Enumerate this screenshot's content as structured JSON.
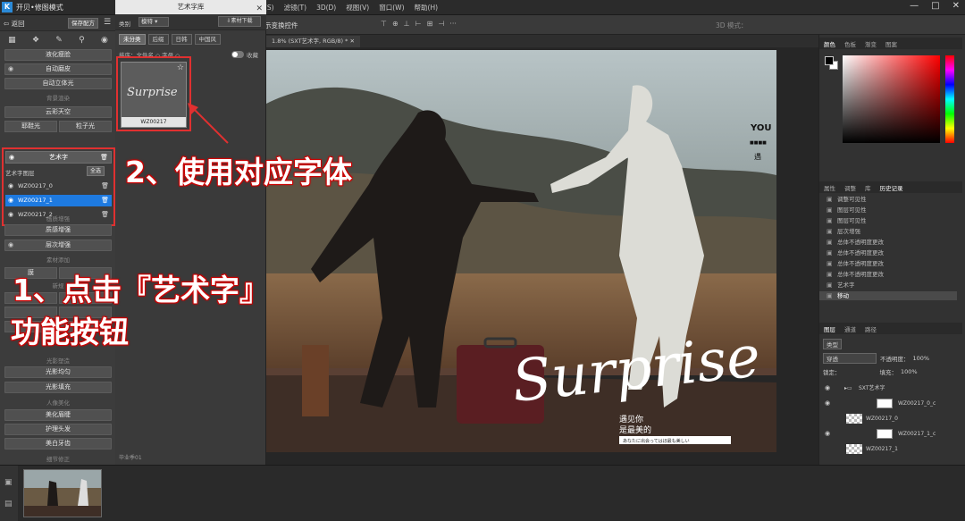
{
  "app": {
    "title": "开贝•修图模式",
    "window_controls": [
      "—",
      "□",
      "✕"
    ]
  },
  "ps_menu": [
    "(S)",
    "滤镜(T)",
    "3D(D)",
    "视图(V)",
    "窗口(W)",
    "帮助(H)"
  ],
  "options_bar": {
    "label": "示变换控件",
    "mode_3d": "3D 模式："
  },
  "plugin": {
    "back_label": "返回",
    "save_label": "保存配方",
    "header_icons": [
      "grid-icon",
      "cube-icon",
      "brush-icon",
      "pin-icon",
      "eye-icon"
    ],
    "buttons_top": [
      "液化瘦脸",
      "自动磨皮",
      "自动立体光"
    ],
    "section_bg": "背景渲染",
    "btn_sky": "云彩天空",
    "btn_bokeh": "耶鞋光",
    "btn_particle": "粒子光",
    "art_button": "艺术字",
    "art_list_label": "艺术字图层",
    "art_all_label": "全选",
    "art_items": [
      "WZ00217_0",
      "WZ00217_1",
      "WZ00217_2"
    ],
    "section_enhance": "画质增强",
    "btn_texture": "质感增强",
    "btn_layer": "层次增强",
    "section_material": "素材添加",
    "btn_light": "膜",
    "section_shadow": "光影塑造",
    "btn_shadow_even": "光影均匀",
    "btn_shadow_fill": "光影填充",
    "section_portrait": "人像美化",
    "btn_brow": "美化眉睫",
    "btn_hair": "护理头发",
    "btn_teeth": "美白牙齿",
    "section_detail": "细节修正",
    "mid_section": "新规"
  },
  "library": {
    "title": "艺术字库",
    "filter_label": "类别",
    "filter_value": "模特",
    "download_label": "素材下载",
    "tabs": [
      "未分类",
      "后缀",
      "日韩",
      "中国风"
    ],
    "sort_label": "排序：文件名 ◇ 字母 ◇",
    "toggle_label": "收藏",
    "thumb_script": "Surprise",
    "thumb_label": "WZ00217",
    "footer": "毕业季01"
  },
  "document": {
    "tab_label": "1.8% (SXT艺术字, RGB/8) *"
  },
  "photo_text": {
    "you": "YOU",
    "you_tag": "■■■■",
    "you_char": "遇",
    "script": "Surprise",
    "sub1": "遇见你",
    "sub2": "是最美的",
    "sub3": "あなたに出会ってはほ最も美しい"
  },
  "right_panels": {
    "color_tabs": [
      "颜色",
      "色板",
      "渐变",
      "图案"
    ],
    "history_tabs": [
      "属性",
      "调整",
      "库",
      "历史记录"
    ],
    "history_items": [
      "调整可见性",
      "图层可见性",
      "图层可见性",
      "层次增强",
      "总体不透明度更改",
      "总体不透明度更改",
      "总体不透明度更改",
      "总体不透明度更改",
      "艺术字",
      "移动"
    ],
    "layer_tabs": [
      "图层",
      "通道",
      "路径"
    ],
    "layer_kind": "类型",
    "blend_mode": "穿透",
    "opacity_label": "不透明度：",
    "opacity": "100%",
    "fill_label": "填充：",
    "fill": "100%",
    "lock_label": "锁定：",
    "layer_items": [
      "SXT艺术字",
      "WZ00217_0_c",
      "WZ00217_0",
      "WZ00217_1_c",
      "WZ00217_1"
    ]
  },
  "annotations": {
    "step1_line1": "1、点击『艺术字』",
    "step1_line2": "功能按钮",
    "step2": "2、使用对应字体"
  },
  "colors": {
    "highlight": "#e03030",
    "selection": "#1e7ae0"
  }
}
